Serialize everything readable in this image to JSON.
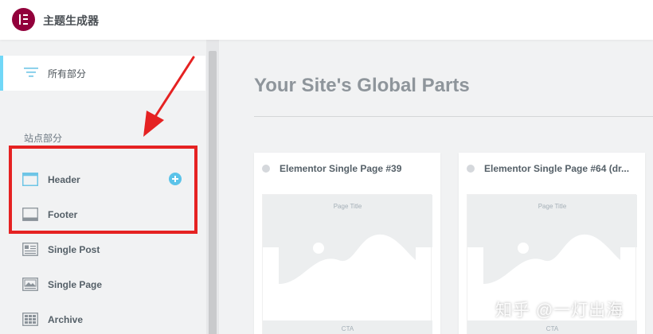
{
  "app": {
    "title": "主题生成器"
  },
  "sidebar": {
    "all_label": "所有部分",
    "section_title": "站点部分",
    "items": [
      {
        "label": "Header",
        "icon": "header-icon"
      },
      {
        "label": "Footer",
        "icon": "footer-icon"
      },
      {
        "label": "Single Post",
        "icon": "single-post-icon"
      },
      {
        "label": "Single Page",
        "icon": "single-page-icon"
      },
      {
        "label": "Archive",
        "icon": "archive-icon"
      }
    ]
  },
  "main": {
    "title": "Your Site's Global Parts",
    "cards": [
      {
        "title": "Elementor Single Page #39",
        "preview_title": "Page Title",
        "preview_cta": "CTA"
      },
      {
        "title": "Elementor Single Page #64 (dr...",
        "preview_title": "Page Title",
        "preview_cta": "CTA"
      }
    ]
  },
  "watermark": "知乎 @一灯出海",
  "colors": {
    "brand": "#92003b",
    "accent": "#71d7f7",
    "add_button": "#5bc3e9",
    "highlight": "#e52222"
  }
}
